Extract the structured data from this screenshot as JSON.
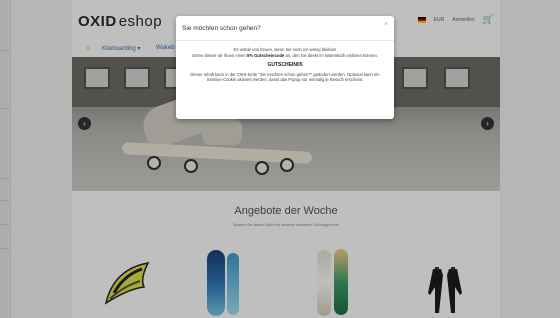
{
  "header": {
    "logo_oxid": "OXID",
    "logo_eshop": "eshop",
    "currency": "EUR",
    "account": "Anmelden",
    "flag_icon": "german-flag-icon",
    "cart_icon": "cart-icon"
  },
  "nav": {
    "home_icon": "home-icon",
    "items": [
      {
        "label": "Kiteboarding ▾"
      },
      {
        "label": "Wakeb"
      }
    ]
  },
  "hero": {
    "prev_icon": "chevron-left-icon",
    "next_icon": "chevron-right-icon"
  },
  "section": {
    "title": "Angebote der Woche",
    "subtitle": "Sparen Sie bares Geld mit unseren aktuellen Schnäppchen!"
  },
  "products": [
    {
      "name": "kite"
    },
    {
      "name": "wakeboard"
    },
    {
      "name": "kiteboard"
    },
    {
      "name": "wetsuit"
    }
  ],
  "modal": {
    "title": "Sie möchten schon gehen?",
    "close": "×",
    "line1": "Es würde uns freuen, wenn Sie noch ein wenig bleiben!",
    "line2_pre": "Gerne bieten wir Ihnen einen",
    "line2_bold": "5% Gutscheincode",
    "line2_post": "an, den Sie direkt im Warenkorb einlösen können.",
    "code": "GUTSCHEIN05",
    "info": "Dieser Inhalt kann in der CMS-Seite \"Sie möchten schon gehen?\" geändert werden. Optional kann ein Session-Cookie aktiviert werden, damit das Popup nur einmalig je Besuch erscheint."
  }
}
